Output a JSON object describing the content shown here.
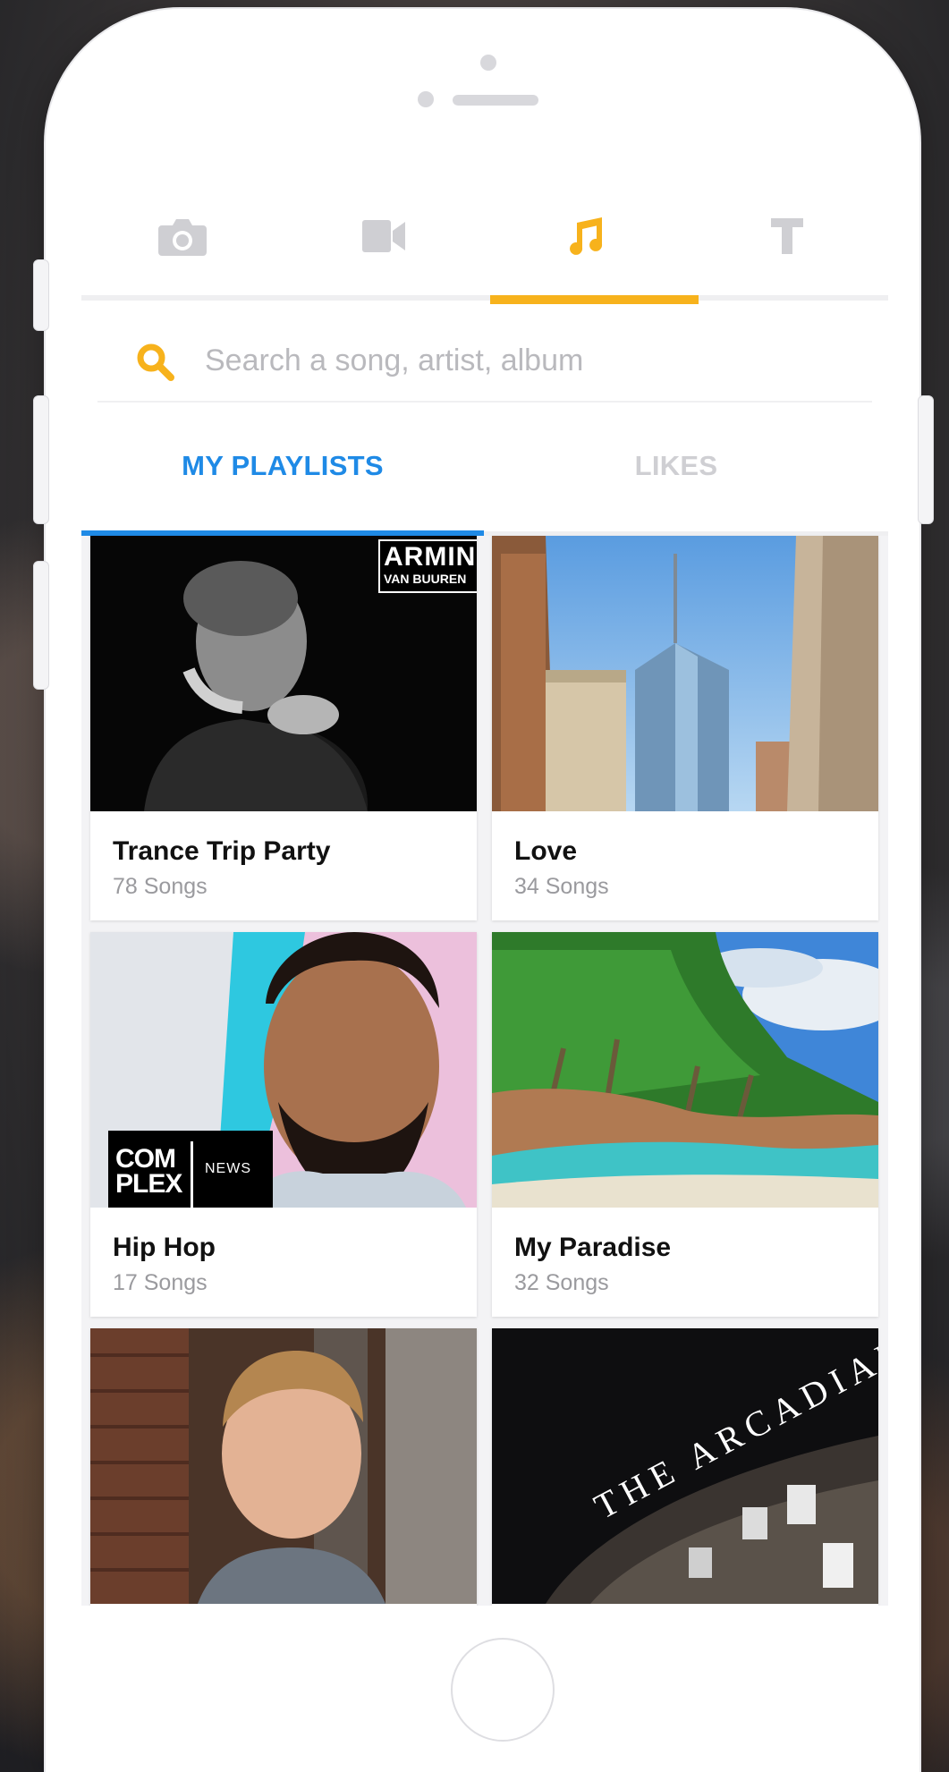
{
  "mode_tabs": [
    {
      "icon": "camera-icon",
      "state": "inactive"
    },
    {
      "icon": "video-icon",
      "state": "inactive"
    },
    {
      "icon": "music-note-icon",
      "state": "active"
    },
    {
      "icon": "text-icon",
      "state": "inactive"
    }
  ],
  "search": {
    "icon": "search-icon",
    "placeholder": "Search a song, artist, album",
    "value": ""
  },
  "sub_tabs": [
    {
      "label": "MY PLAYLISTS",
      "state": "active"
    },
    {
      "label": "LIKES",
      "state": "inactive"
    }
  ],
  "playlists": [
    {
      "title": "Trance Trip Party",
      "count": "78 Songs",
      "badge_line1": "ARMIN",
      "badge_line2": "VAN BUUREN"
    },
    {
      "title": "Love",
      "count": "34 Songs"
    },
    {
      "title": "Hip Hop",
      "count": "17 Songs",
      "badge_left": "COM PLEX",
      "badge_right": "NEWS"
    },
    {
      "title": "My Paradise",
      "count": "32 Songs"
    },
    {
      "title": "",
      "count": ""
    },
    {
      "title": "",
      "count": "",
      "sign": "THE ARCADIAN"
    }
  ],
  "colors": {
    "accent_orange": "#f7b21c",
    "accent_blue": "#1f8ae6",
    "inactive_icon": "#cfcfd3"
  }
}
